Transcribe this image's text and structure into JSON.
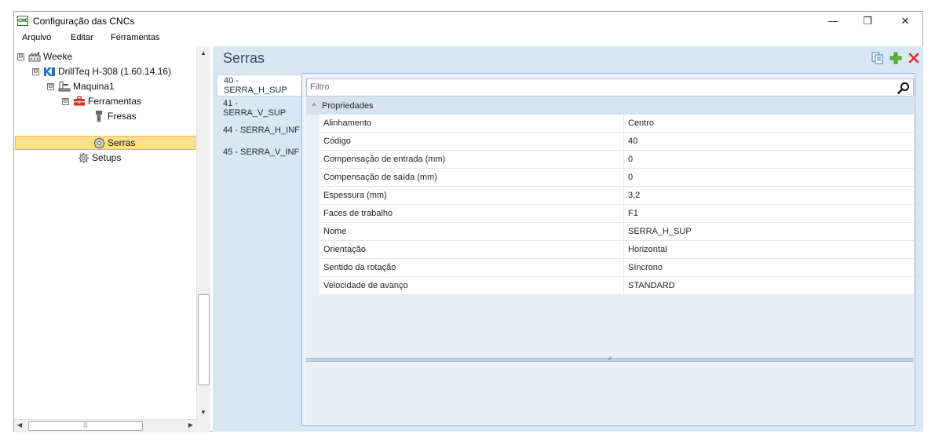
{
  "window": {
    "title": "Configuração das CNCs",
    "icon_text": "CNC",
    "controls": {
      "minimize": "—",
      "maximize": "❐",
      "close": "✕"
    }
  },
  "menu": {
    "items": [
      "Arquivo",
      "Editar",
      "Ferramentas"
    ]
  },
  "tree": {
    "nodes": [
      {
        "label": "Weeke",
        "expander": "⊟",
        "icon": "factory-icon"
      },
      {
        "label": "DrillTeq H-308 (1.60.14.16)",
        "expander": "⊟",
        "icon": "drillteq-icon"
      },
      {
        "label": "Maquina1",
        "expander": "⊟",
        "icon": "machine-icon"
      },
      {
        "label": "Ferramentas",
        "expander": "⊟",
        "icon": "toolbox-icon"
      },
      {
        "label": "Fresas",
        "icon": "mill-icon"
      },
      {
        "label": "Serras",
        "icon": "saw-icon",
        "selected": true
      },
      {
        "label": "Setups",
        "icon": "gear-icon"
      }
    ]
  },
  "panel": {
    "title": "Serras",
    "toolbar": {
      "copy_icon": "copy-icon",
      "add_icon": "add-icon",
      "delete_icon": "delete-icon"
    },
    "tabs": [
      {
        "label": "40 - SERRA_H_SUP",
        "active": true
      },
      {
        "label": "41 - SERRA_V_SUP"
      },
      {
        "label": "44 - SERRA_H_INF"
      },
      {
        "label": "45 - SERRA_V_INF"
      }
    ],
    "filter": {
      "placeholder": "Filtro"
    },
    "category": {
      "toggle": "^",
      "label": "Propriedades"
    },
    "properties": [
      {
        "name": "Alinhamento",
        "value": "Centro"
      },
      {
        "name": "Código",
        "value": "40"
      },
      {
        "name": "Compensação de entrada (mm)",
        "value": "0"
      },
      {
        "name": "Compensação de saída (mm)",
        "value": "0"
      },
      {
        "name": "Espessura (mm)",
        "value": "3,2"
      },
      {
        "name": "Faces de trabalho",
        "value": "F1"
      },
      {
        "name": "Nome",
        "value": "SERRA_H_SUP"
      },
      {
        "name": "Orientação",
        "value": "Horizontal"
      },
      {
        "name": "Sentido da rotação",
        "value": "Síncrono"
      },
      {
        "name": "Velocidade de avanço",
        "value": "STANDARD"
      }
    ]
  },
  "colors": {
    "selection_fill": "#fce08f",
    "selection_border": "#e7b74c",
    "panel_background": "#d8e6f5",
    "add_green": "#5cb82e",
    "delete_red": "#e0302a"
  }
}
